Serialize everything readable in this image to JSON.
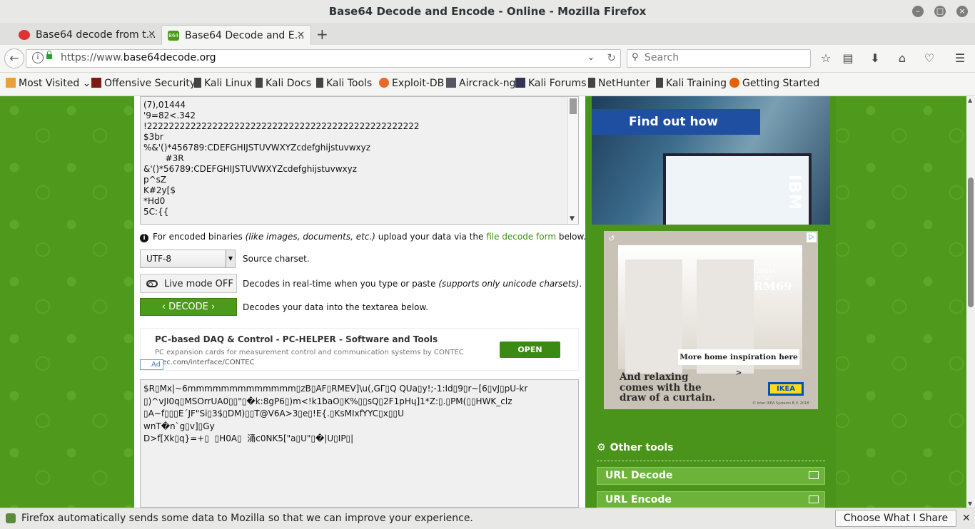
{
  "window": {
    "title": "Base64 Decode and Encode - Online - Mozilla Firefox"
  },
  "tabs": [
    {
      "label": "Base64 decode from t…"
    },
    {
      "label": "Base64 Decode and E…"
    }
  ],
  "nav": {
    "url_prefix": "https://www.",
    "url_domain": "base64decode.org",
    "search_placeholder": "Search"
  },
  "bookmarks": [
    {
      "label": "Most Visited"
    },
    {
      "label": "Offensive Security"
    },
    {
      "label": "Kali Linux"
    },
    {
      "label": "Kali Docs"
    },
    {
      "label": "Kali Tools"
    },
    {
      "label": "Exploit-DB"
    },
    {
      "label": "Aircrack-ng"
    },
    {
      "label": "Kali Forums"
    },
    {
      "label": "NetHunter"
    },
    {
      "label": "Kali Training"
    },
    {
      "label": "Getting Started"
    }
  ],
  "encoded_lines": [
    "(7),01444",
    "'9=82<.342",
    "!22222222222222222222222222222222222222222222222222",
    "$3br",
    "%&'()*456789:CDEFGHIJSTUVWXYZcdefghijstuvwxyz",
    "        #3R",
    "&'()*56789:CDEFGHIJSTUVWXYZcdefghijstuvwxyz",
    "p^sZ",
    "K#2y[$",
    "*Hd0",
    "5C:{{"
  ],
  "note": {
    "prefix": "For encoded binaries ",
    "italic": "(like images, documents, etc.)",
    "middle": " upload your data via the ",
    "link": "file decode form",
    "suffix": " below."
  },
  "charset": {
    "value": "UTF-8",
    "label": "Source charset."
  },
  "live_mode": {
    "button": "Live mode OFF",
    "desc": "Decodes in real-time when you type or paste ",
    "desc_italic": "(supports only unicode charsets)",
    "desc_end": "."
  },
  "decode": {
    "button": "DECODE",
    "desc": "Decodes your data into the textarea below."
  },
  "ad": {
    "headline": "PC-based DAQ & Control - PC-HELPER - Software and Tools",
    "desc": "PC expansion cards for measurement control and communication systems by CONTEC",
    "url": "ntec.com/interface/CONTEC",
    "open": "OPEN",
    "tag": "Ad"
  },
  "decoded_lines": [
    "$R▯Mx|~6mmmmmmmmmmmmm▯zB▯AF▯RMEV]\\u(,GΓ▯Q QUa▯y!;-1:Id▯9▯r~[6▯vJ▯pU-kr",
    "▯)^vJI0q▯MSOrrUA0▯▯\"▯�k:8gP6▯)m<!k1ƀaO▯K%▯▯sQ▯2F1pHɥ]1*Z:▯.▯PM(▯▯HWK_clz",
    "▯A~f▯▯▯E´JF\"Si▯3$▯DM)▯▯T@V6A>3▯e▯!E{.▯KsMIxfYYC▯x▯▯U",
    "wnT�n`g▯v]▯Gy",
    "D>f[Xk▯q}=+▯  ▯H0A▯  涌c0NK5[\"a▯U\"▯�|U▯IP▯|"
  ],
  "sidebar": {
    "ibm_cta": "Find out how",
    "ibm_brand": "IBM",
    "ikea_product": "LENDA",
    "ikea_sub": "curtain",
    "ikea_price": "RM69",
    "ikea_more": "More home inspiration here >",
    "ikea_tagline": "And relaxing\ncomes with the\ndraw of a curtain.",
    "ikea_logo": "IKEA",
    "ikea_copy": "© Inter IKEA Systems B.V. 2018",
    "other_tools_title": "Other tools",
    "tools": [
      {
        "label": "URL Decode"
      },
      {
        "label": "URL Encode"
      }
    ]
  },
  "notification": {
    "text": "Firefox automatically sends some data to Mozilla so that we can improve your experience.",
    "button": "Choose What I Share"
  }
}
